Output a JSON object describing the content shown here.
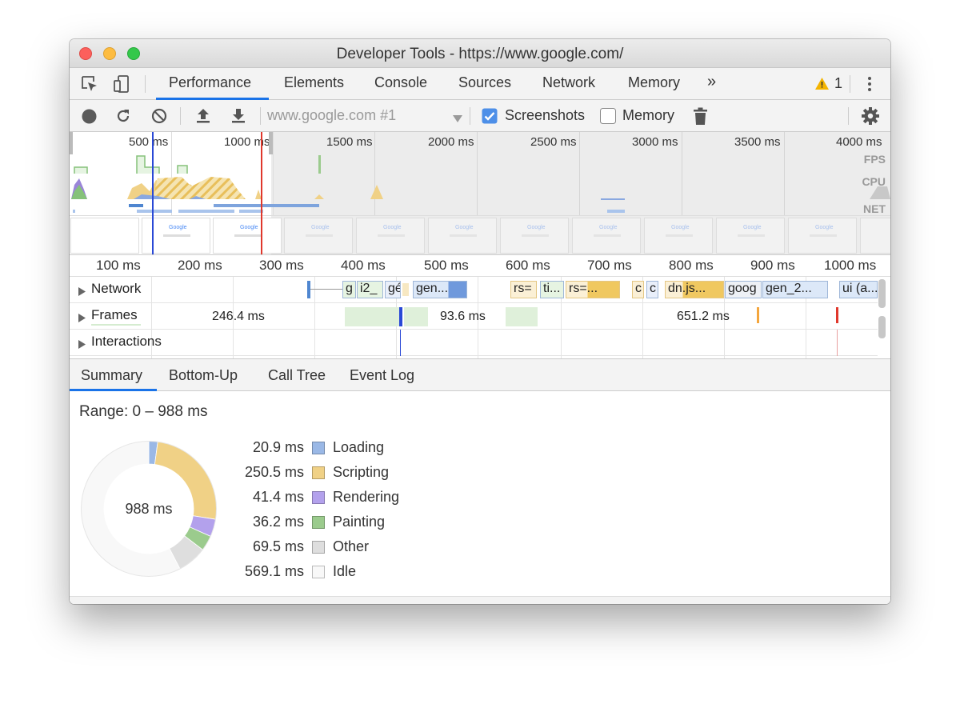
{
  "window": {
    "title": "Developer Tools - https://www.google.com/"
  },
  "tabs": [
    {
      "label": "Performance",
      "active": true
    },
    {
      "label": "Elements"
    },
    {
      "label": "Console"
    },
    {
      "label": "Sources"
    },
    {
      "label": "Network"
    },
    {
      "label": "Memory"
    }
  ],
  "tabs_more": "»",
  "warnings": {
    "count": "1"
  },
  "toolbar": {
    "profile_select": "www.google.com #1",
    "screenshots_label": "Screenshots",
    "screenshots_checked": true,
    "memory_label": "Memory",
    "memory_checked": false
  },
  "overview": {
    "ruler": [
      "500 ms",
      "1000 ms",
      "1500 ms",
      "2000 ms",
      "2500 ms",
      "3000 ms",
      "3500 ms",
      "4000 ms"
    ],
    "lanes": {
      "fps": "FPS",
      "cpu": "CPU",
      "net": "NET"
    },
    "screenshot_text": "Google"
  },
  "flamechart": {
    "ruler": [
      "100 ms",
      "200 ms",
      "300 ms",
      "400 ms",
      "500 ms",
      "600 ms",
      "700 ms",
      "800 ms",
      "900 ms",
      "1000 ms"
    ],
    "tracks": {
      "network": "Network",
      "frames": "Frames",
      "interactions": "Interactions"
    },
    "requests": [
      "g",
      "i2_",
      "gé",
      "gen...",
      "rs=",
      "ti...",
      "rs=...",
      "c",
      "c",
      "dn.js...",
      "goog",
      "gen_2...",
      "ui (a..."
    ],
    "frame_times": [
      "246.4 ms",
      "93.6 ms",
      "651.2 ms"
    ]
  },
  "bottom_tabs": [
    {
      "label": "Summary",
      "active": true
    },
    {
      "label": "Bottom-Up"
    },
    {
      "label": "Call Tree"
    },
    {
      "label": "Event Log"
    }
  ],
  "summary": {
    "range": "Range: 0 – 988 ms",
    "total": "988 ms",
    "categories": [
      {
        "value": "20.9 ms",
        "label": "Loading",
        "ms": 20.9,
        "color": "#9ab8e6"
      },
      {
        "value": "250.5 ms",
        "label": "Scripting",
        "ms": 250.5,
        "color": "#f0d186"
      },
      {
        "value": "41.4 ms",
        "label": "Rendering",
        "ms": 41.4,
        "color": "#b3a1ec"
      },
      {
        "value": "36.2 ms",
        "label": "Painting",
        "ms": 36.2,
        "color": "#9bcb8d"
      },
      {
        "value": "69.5 ms",
        "label": "Other",
        "ms": 69.5,
        "color": "#dedede"
      },
      {
        "value": "569.1 ms",
        "label": "Idle",
        "ms": 569.1,
        "color": "#f8f8f8"
      }
    ]
  }
}
